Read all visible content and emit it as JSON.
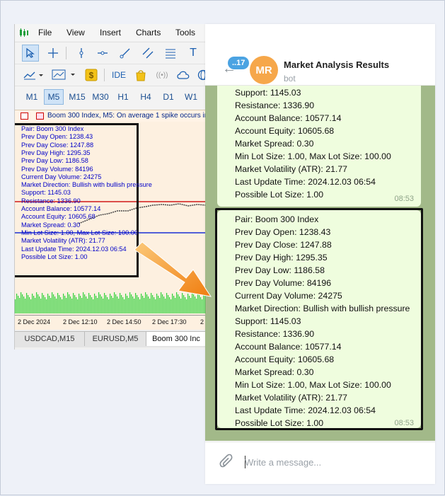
{
  "mt": {
    "menu": [
      "File",
      "View",
      "Insert",
      "Charts",
      "Tools"
    ],
    "timeframes": [
      "M1",
      "M5",
      "M15",
      "M30",
      "H1",
      "H4",
      "D1",
      "W1"
    ],
    "selected_timeframe": "M5",
    "toolbar2_ide": "IDE",
    "chart_header": "Boom 300 Index, M5:  On average 1 spike occurs in",
    "overlay_lines": [
      "Pair: Boom 300 Index",
      "Prev Day Open: 1238.43",
      "Prev Day Close: 1247.88",
      "Prev Day High: 1295.35",
      "Prev Day Low: 1186.58",
      "Prev Day Volume: 84196",
      "Current Day Volume: 24275",
      "Market Direction: Bullish with bullish pressure",
      "Support: 1145.03",
      "Resistance: 1336.90",
      "Account Balance: 10577.14",
      "Account Equity: 10605.68",
      "Market Spread: 0.30",
      "Min Lot Size: 1.00, Max Lot Size: 100.00",
      "Market Volatility (ATR): 21.77",
      "Last Update Time: 2024.12.03 06:54",
      "Possible Lot Size: 1.00"
    ],
    "time_axis": [
      "2 Dec 2024",
      "2 Dec 12:10",
      "2 Dec 14:50",
      "2 Dec 17:30",
      "2"
    ],
    "tabs": [
      "USDCAD,M15",
      "EURUSD,M5",
      "Boom 300 Inc"
    ],
    "active_tab": 2,
    "colors": {
      "resistance_line": "#d11919",
      "support_line": "#1a2fd6",
      "volume_bars": "#2fd13a",
      "overlay_text": "#0000c8"
    }
  },
  "tg": {
    "unread_badge": "..17",
    "avatar_initials": "MR",
    "chat_title": "Market Analysis Results",
    "chat_subtitle": "bot",
    "bubble1_lines": [
      "Support: 1145.03",
      "Resistance: 1336.90",
      "Account Balance: 10577.14",
      "Account Equity: 10605.68",
      "Market Spread: 0.30",
      "Min Lot Size: 1.00, Max Lot Size: 100.00",
      "Market Volatility (ATR): 21.77",
      "Last Update Time: 2024.12.03 06:54",
      "Possible Lot Size: 1.00"
    ],
    "bubble1_time": "08:53",
    "bubble2_lines": [
      "Pair: Boom 300 Index",
      "Prev Day Open: 1238.43",
      "Prev Day Close: 1247.88",
      "Prev Day High: 1295.35",
      "Prev Day Low: 1186.58",
      "Prev Day Volume: 84196",
      "Current Day Volume: 24275",
      "Market Direction: Bullish with bullish pressure",
      "Support: 1145.03",
      "Resistance: 1336.90",
      "Account Balance: 10577.14",
      "Account Equity: 10605.68",
      "Market Spread: 0.30",
      "Min Lot Size: 1.00, Max Lot Size: 100.00",
      "Market Volatility (ATR): 21.77",
      "Last Update Time: 2024.12.03 06:54",
      "Possible Lot Size: 1.00"
    ],
    "bubble2_time": "08:53",
    "input_placeholder": "Write a message...",
    "colors": {
      "chat_bg": "#a2b989",
      "bubble": "#effdde",
      "avatar": "#f6a74a",
      "badge": "#4ba3e2",
      "arrow": "#f28c1a"
    }
  }
}
